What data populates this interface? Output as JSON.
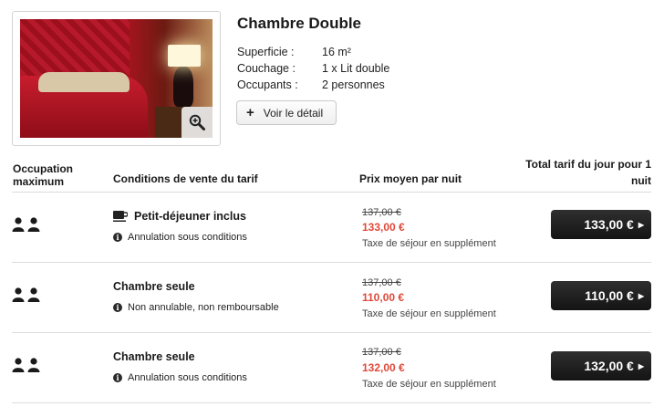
{
  "room": {
    "title": "Chambre Double",
    "specs": [
      {
        "label": "Superficie :",
        "value": "16 m²"
      },
      {
        "label": "Couchage :",
        "value": "1 x Lit double"
      },
      {
        "label": "Occupants :",
        "value": "2 personnes"
      }
    ],
    "detail_button": "Voir le détail"
  },
  "table": {
    "headers": {
      "occupation": "Occupation maximum",
      "conditions": "Conditions de vente du tarif",
      "price": "Prix moyen par nuit",
      "total": "Total tarif du jour pour 1 nuit"
    },
    "offers": [
      {
        "persons": 2,
        "title": "Petit-déjeuner inclus",
        "has_breakfast_icon": true,
        "condition": "Annulation sous conditions",
        "old_price": "137,00 €",
        "new_price": "133,00 €",
        "tax_note": "Taxe de séjour en supplément",
        "total": "133,00 €"
      },
      {
        "persons": 2,
        "title": "Chambre seule",
        "has_breakfast_icon": false,
        "condition": "Non annulable, non remboursable",
        "old_price": "137,00 €",
        "new_price": "110,00 €",
        "tax_note": "Taxe de séjour en supplément",
        "total": "110,00 €"
      },
      {
        "persons": 2,
        "title": "Chambre seule",
        "has_breakfast_icon": false,
        "condition": "Annulation sous conditions",
        "old_price": "137,00 €",
        "new_price": "132,00 €",
        "tax_note": "Taxe de séjour en supplément",
        "total": "132,00 €"
      }
    ]
  },
  "colors": {
    "discount_price": "#e0493a",
    "total_button": "#1c1c1c"
  }
}
